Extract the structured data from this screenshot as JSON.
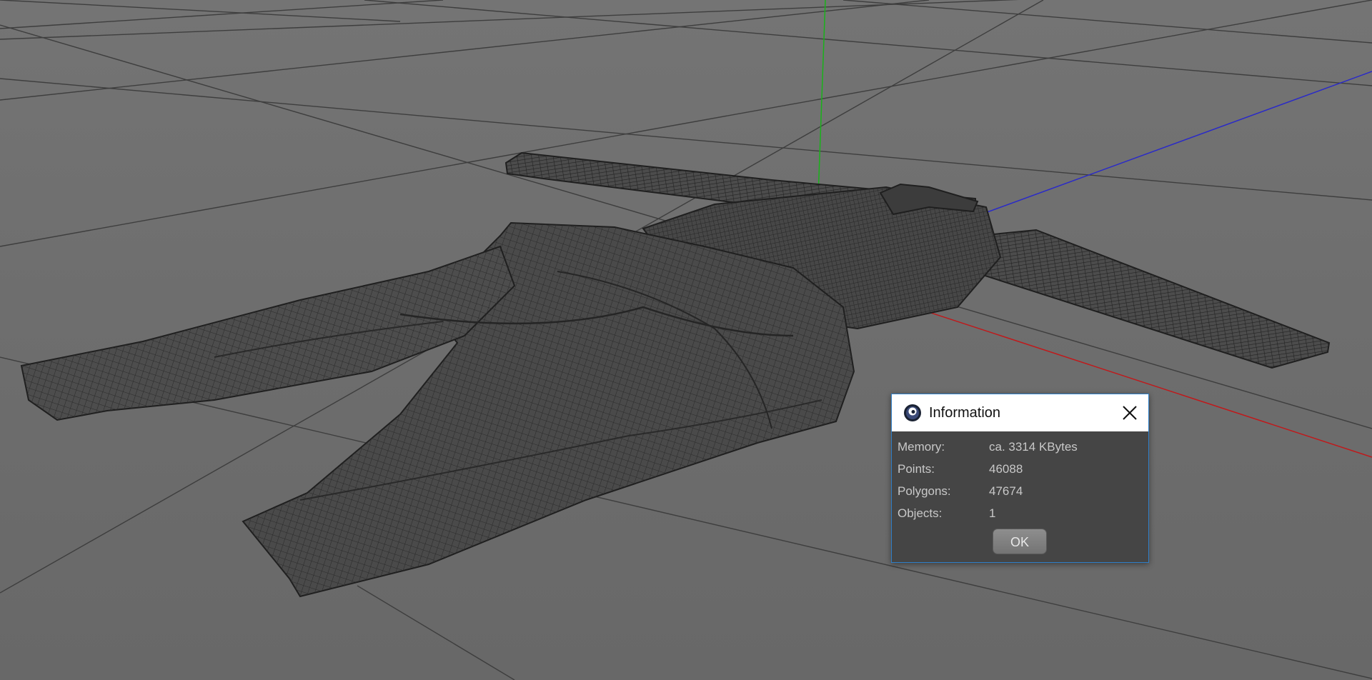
{
  "viewport": {
    "axis_colors": {
      "x": "#c0191b",
      "y": "#19b21a",
      "z": "#2a2ac8"
    },
    "grid_color": "#3a3a3a",
    "mesh_color": "#2b2b2b"
  },
  "dialog": {
    "title": "Information",
    "app_icon": "cinema4d-logo-icon",
    "close_icon": "close-icon",
    "rows": [
      {
        "label": "Memory:",
        "value": "ca. 3314 KBytes"
      },
      {
        "label": "Points:",
        "value": "46088"
      },
      {
        "label": "Polygons:",
        "value": "47674"
      },
      {
        "label": "Objects:",
        "value": "1"
      }
    ],
    "ok_label": "OK",
    "border_color": "#2f7fc8"
  }
}
